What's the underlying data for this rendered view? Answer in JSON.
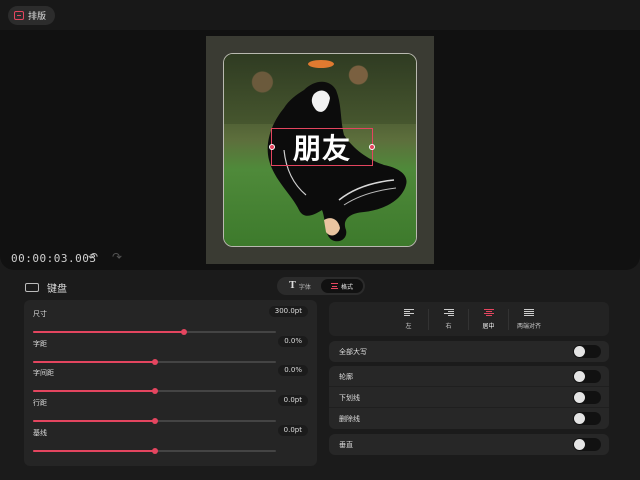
{
  "topbar": {
    "layout_button_label": "排版"
  },
  "canvas": {
    "overlay_text": "朋友"
  },
  "playback": {
    "timecode": "00:00:03.003",
    "undo_glyph": "↶",
    "redo_glyph": "↷"
  },
  "panel": {
    "keyboard_label": "键盘",
    "tabs": [
      {
        "label": "字体",
        "active": false
      },
      {
        "label": "格式",
        "active": true
      }
    ]
  },
  "sliders": [
    {
      "label": "尺寸",
      "value": "300.0pt",
      "fraction": 0.62
    },
    {
      "label": "字距",
      "value": "0.0%",
      "fraction": 0.5
    },
    {
      "label": "字间距",
      "value": "0.0%",
      "fraction": 0.5
    },
    {
      "label": "行距",
      "value": "0.0pt",
      "fraction": 0.5
    },
    {
      "label": "基线",
      "value": "0.0pt",
      "fraction": 0.5
    }
  ],
  "alignment": {
    "options": [
      {
        "label": "左",
        "icon": "align-left-icon"
      },
      {
        "label": "右",
        "icon": "align-right-icon"
      },
      {
        "label": "居中",
        "icon": "align-center-icon",
        "active": true
      },
      {
        "label": "两端对齐",
        "icon": "align-justify-icon"
      }
    ]
  },
  "toggles": {
    "all_caps": "全部大写",
    "outline": "轮廓",
    "underline": "下划线",
    "strikethrough": "删除线",
    "vertical": "垂直"
  },
  "colors": {
    "accent": "#e4455f"
  }
}
